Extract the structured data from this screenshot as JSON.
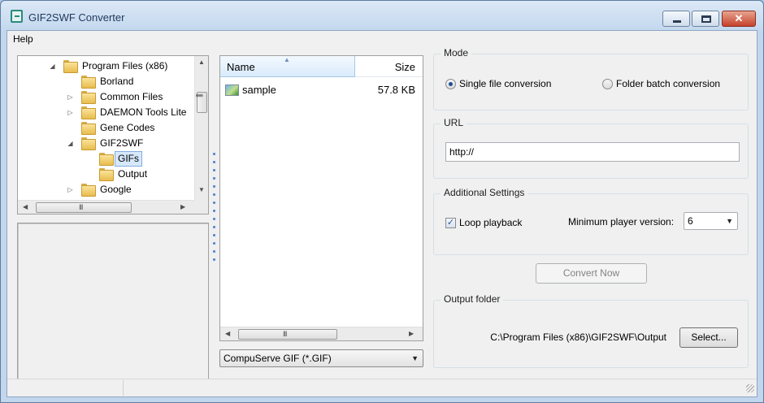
{
  "window": {
    "title": "GIF2SWF Converter",
    "icon": "gif2swf-app-icon",
    "controls": {
      "minimize": "minimize-icon",
      "maximize": "maximize-icon",
      "close": "close-icon"
    }
  },
  "menu": {
    "items": [
      {
        "label": "Help"
      }
    ]
  },
  "folder_tree": {
    "items": [
      {
        "label": "Program Files (x86)",
        "expander": "expanded",
        "level": 0
      },
      {
        "label": "Borland",
        "expander": "none",
        "level": 1
      },
      {
        "label": "Common Files",
        "expander": "collapsed",
        "level": 1
      },
      {
        "label": "DAEMON Tools Lite",
        "expander": "collapsed",
        "level": 1
      },
      {
        "label": "Gene Codes",
        "expander": "none",
        "level": 1
      },
      {
        "label": "GIF2SWF",
        "expander": "expanded",
        "level": 1
      },
      {
        "label": "GIFs",
        "expander": "none",
        "level": 2,
        "selected": true
      },
      {
        "label": "Output",
        "expander": "none",
        "level": 2
      },
      {
        "label": "Google",
        "expander": "collapsed",
        "level": 1
      }
    ]
  },
  "file_list": {
    "columns": {
      "name": "Name",
      "size": "Size"
    },
    "rows": [
      {
        "name": "sample",
        "size": "57.8 KB",
        "icon": "gif-image-icon"
      }
    ],
    "filter": {
      "selected": "CompuServe GIF (*.GIF)"
    }
  },
  "mode": {
    "title": "Mode",
    "single_label": "Single file conversion",
    "folder_label": "Folder batch conversion",
    "selected": "single"
  },
  "url": {
    "title": "URL",
    "value": "http://"
  },
  "settings": {
    "title": "Additional Settings",
    "loop_label": "Loop playback",
    "loop_checked": true,
    "check_glyph": "✓",
    "version_label": "Minimum player version:",
    "version_value": "6"
  },
  "convert": {
    "label": "Convert Now",
    "enabled": false
  },
  "output": {
    "title": "Output folder",
    "path": "C:\\Program Files (x86)\\GIF2SWF\\Output",
    "select_label": "Select..."
  },
  "scroll_glyphs": {
    "up": "▲",
    "down": "▼",
    "left": "◀",
    "right": "▶",
    "grip_v": "|||",
    "grip_h": "III",
    "caret": "▼",
    "sort": "▲"
  },
  "expander_glyphs": {
    "expanded": "◢",
    "collapsed": "▷",
    "none": ""
  }
}
